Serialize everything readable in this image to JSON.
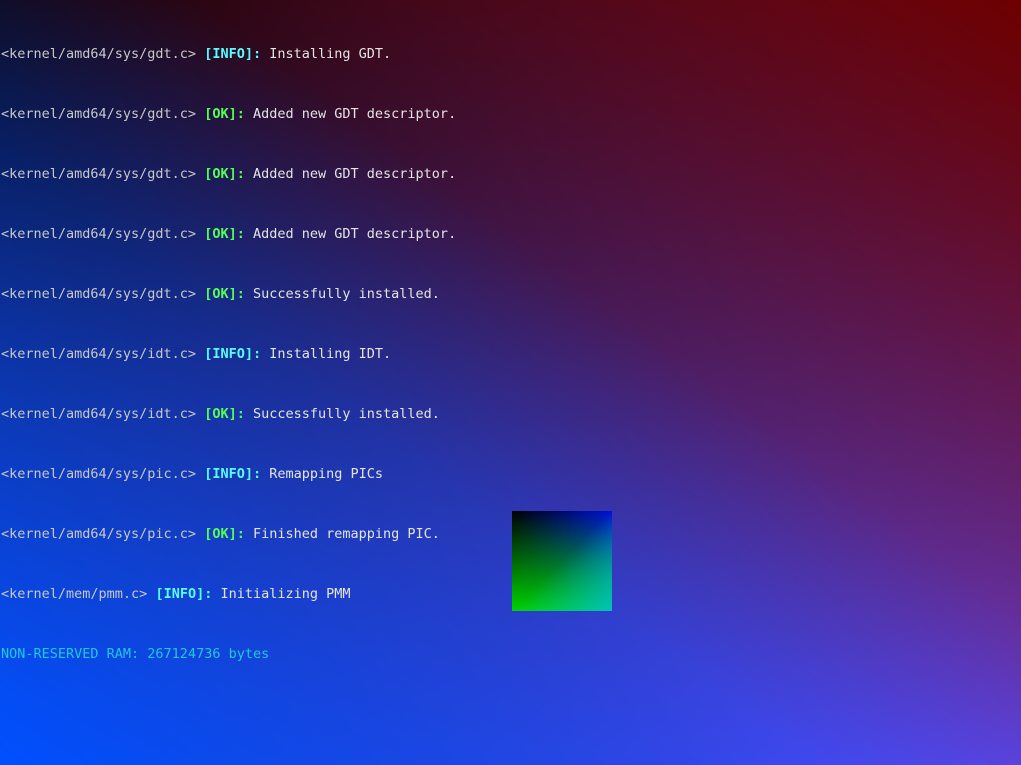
{
  "screen": {
    "background_colors": {
      "top_left": "#000000",
      "top_right": "#6e0000",
      "bottom_left": "#0050ff",
      "bottom_right": "#6a4cff"
    },
    "test_square_colors": {
      "top_left": "#000000",
      "top_right": "#0010d8",
      "bottom_left": "#00d200",
      "bottom_right": "#00c8d8"
    }
  },
  "console": {
    "lines": [
      {
        "source": "<kernel/amd64/sys/gdt.c>",
        "tag": "[INFO]:",
        "message": "Installing GDT."
      },
      {
        "source": "<kernel/amd64/sys/gdt.c>",
        "tag": "[OK]:",
        "message": "Added new GDT descriptor."
      },
      {
        "source": "<kernel/amd64/sys/gdt.c>",
        "tag": "[OK]:",
        "message": "Added new GDT descriptor."
      },
      {
        "source": "<kernel/amd64/sys/gdt.c>",
        "tag": "[OK]:",
        "message": "Added new GDT descriptor."
      },
      {
        "source": "<kernel/amd64/sys/gdt.c>",
        "tag": "[OK]:",
        "message": "Successfully installed."
      },
      {
        "source": "<kernel/amd64/sys/idt.c>",
        "tag": "[INFO]:",
        "message": "Installing IDT."
      },
      {
        "source": "<kernel/amd64/sys/idt.c>",
        "tag": "[OK]:",
        "message": "Successfully installed."
      },
      {
        "source": "<kernel/amd64/sys/pic.c>",
        "tag": "[INFO]:",
        "message": "Remapping PICs"
      },
      {
        "source": "<kernel/amd64/sys/pic.c>",
        "tag": "[OK]:",
        "message": "Finished remapping PIC."
      },
      {
        "source": "<kernel/mem/pmm.c>",
        "tag": "[INFO]:",
        "message": "Initializing PMM"
      }
    ],
    "ram_line": "NON-RESERVED RAM: 267124736 bytes"
  }
}
